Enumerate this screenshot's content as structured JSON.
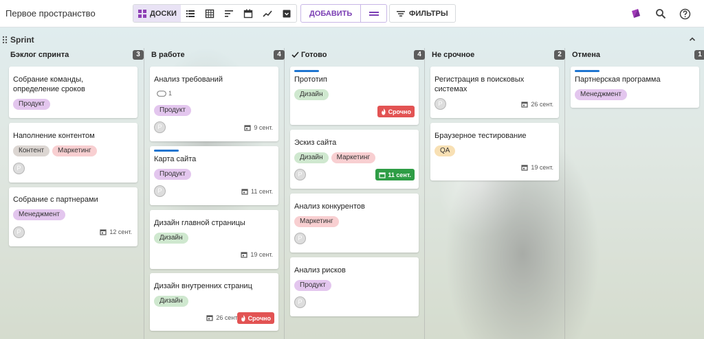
{
  "colors": {
    "accent": "#7b3fb4",
    "view_active_bg": "#e9e3f5",
    "card_bar": "#1e75d0",
    "tag_product": "#e3c6ee",
    "tag_content": "#dcd6d2",
    "tag_marketing": "#f8cfd1",
    "tag_management": "#e3c6ee",
    "tag_design": "#cfe8cf",
    "tag_qa": "#f8e0b4",
    "urgent": "#e25353",
    "due_green": "#2e9d45"
  },
  "header": {
    "space_title": "Первое пространство",
    "view_boards_label": "ДОСКИ",
    "add_label": "ДОБАВИТЬ",
    "filters_label": "ФИЛЬТРЫ",
    "icons": [
      "boards-icon",
      "list-icon",
      "table-icon",
      "gantt-icon",
      "calendar-icon",
      "chart-icon",
      "archive-icon",
      "menu-icon",
      "filter-icon",
      "theme-icon",
      "search-icon",
      "help-icon"
    ]
  },
  "group": {
    "title": "Sprint"
  },
  "columns": [
    {
      "title": "Бэклог спринта",
      "count": "3",
      "cards": [
        {
          "title": "Собрание команды, определение сроков",
          "tags": [
            "Продукт"
          ]
        },
        {
          "title": "Наполнение контентом",
          "tags": [
            "Контент",
            "Маркетинг"
          ],
          "avatar": "P"
        },
        {
          "title": "Собрание с партнерами",
          "tags": [
            "Менеджмент"
          ],
          "avatar": "P",
          "due": "12 сент."
        }
      ]
    },
    {
      "title": "В работе",
      "count": "4",
      "cards": [
        {
          "title": "Анализ требований",
          "comments": "1",
          "tags": [
            "Продукт"
          ],
          "avatar": "P",
          "due": "9 сент."
        },
        {
          "title": "Карта сайта",
          "tags": [
            "Продукт"
          ],
          "avatar": "P",
          "due": "11 сент."
        },
        {
          "title": "Дизайн главной страницы",
          "tags": [
            "Дизайн"
          ],
          "due": "19 сент."
        },
        {
          "title": "Дизайн внутренних страниц",
          "tags": [
            "Дизайн"
          ],
          "due": "26 сент.",
          "badge": "Срочно"
        }
      ]
    },
    {
      "title": "Готово",
      "count": "4",
      "cards": [
        {
          "title": "Прототип",
          "tags": [
            "Дизайн"
          ],
          "badge": "Срочно"
        },
        {
          "title": "Эскиз сайта",
          "tags": [
            "Дизайн",
            "Маркетинг"
          ],
          "avatar": "P",
          "badge": "11 сент."
        },
        {
          "title": "Анализ конкурентов",
          "tags": [
            "Маркетинг"
          ],
          "avatar": "P"
        },
        {
          "title": "Анализ рисков",
          "tags": [
            "Продукт"
          ],
          "avatar": "P"
        }
      ]
    },
    {
      "title": "Не срочное",
      "count": "2",
      "cards": [
        {
          "title": "Регистрация в поисковых системах",
          "avatar": "P",
          "due": "26 сент."
        },
        {
          "title": "Браузерное тестирование",
          "tags": [
            "QA"
          ],
          "due": "19 сент."
        }
      ]
    },
    {
      "title": "Отмена",
      "count": "1",
      "cards": [
        {
          "title": "Партнерская программа",
          "tags": [
            "Менеджмент"
          ]
        }
      ]
    }
  ]
}
